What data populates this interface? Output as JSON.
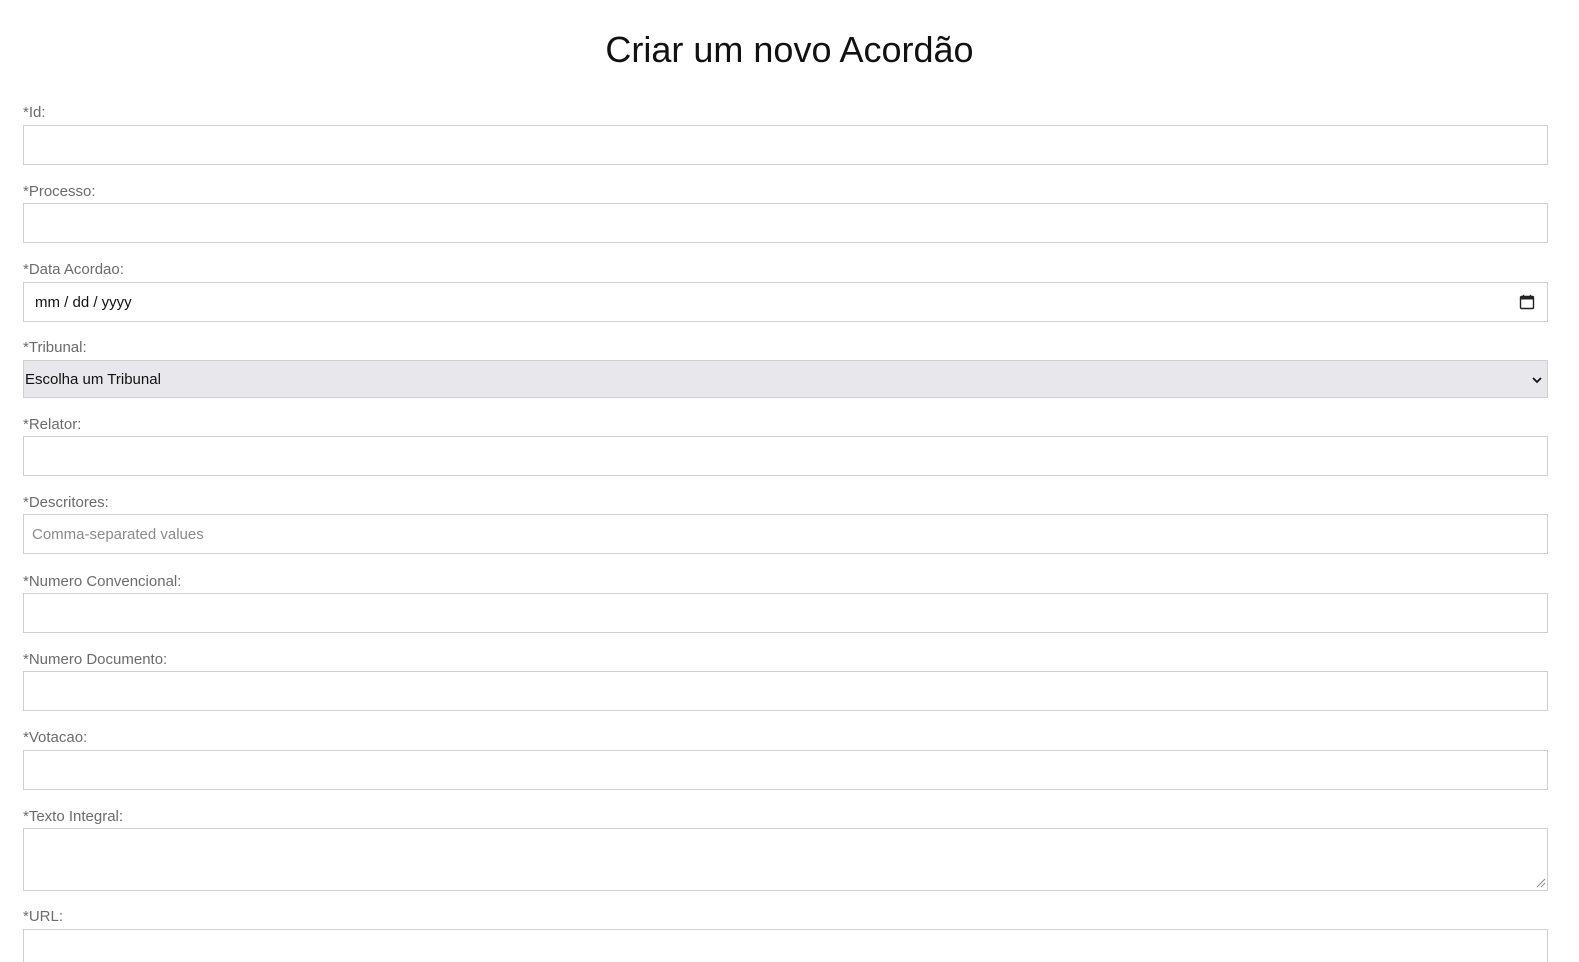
{
  "page": {
    "title": "Criar um novo Acordão"
  },
  "form": {
    "id": {
      "label": "*Id:",
      "value": "",
      "placeholder": ""
    },
    "processo": {
      "label": "*Processo:",
      "value": "",
      "placeholder": ""
    },
    "data_acordao": {
      "label": "*Data Acordao:",
      "display": "mm / dd / yyyy",
      "icon": "calendar-icon"
    },
    "tribunal": {
      "label": "*Tribunal:",
      "selected": "Escolha um Tribunal",
      "icon": "chevron-down-icon"
    },
    "relator": {
      "label": "*Relator:",
      "value": "",
      "placeholder": ""
    },
    "descritores": {
      "label": "*Descritores:",
      "value": "",
      "placeholder": "Comma-separated values"
    },
    "numero_convencional": {
      "label": "*Numero Convencional:",
      "value": "",
      "placeholder": ""
    },
    "numero_documento": {
      "label": "*Numero Documento:",
      "value": "",
      "placeholder": ""
    },
    "votacao": {
      "label": "*Votacao:",
      "value": "",
      "placeholder": ""
    },
    "texto_integral": {
      "label": "*Texto Integral:",
      "value": ""
    },
    "url": {
      "label": "*URL:",
      "value": "",
      "placeholder": ""
    }
  },
  "colors": {
    "label": "#6b6b6b",
    "border": "#cfcfcf",
    "select_bg": "#e8e8ec"
  }
}
